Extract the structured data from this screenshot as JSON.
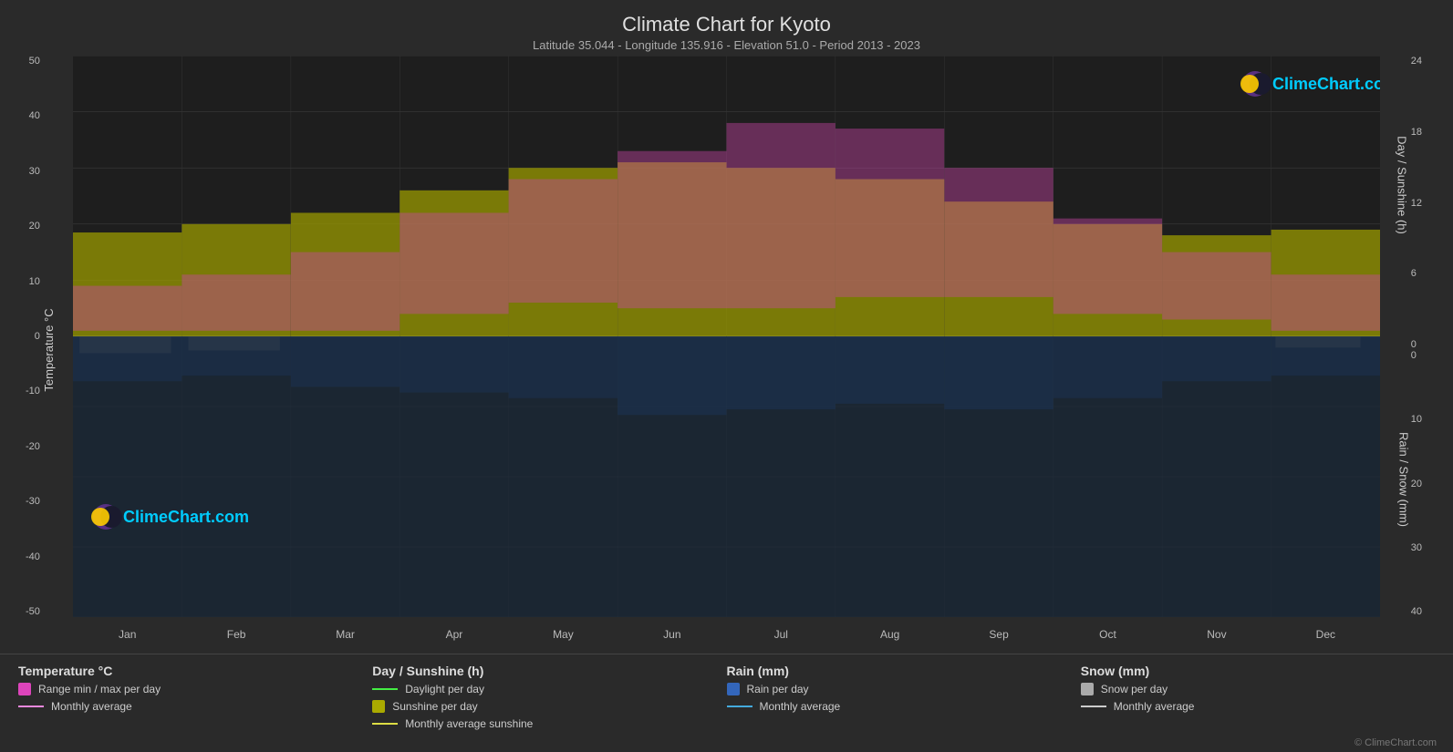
{
  "header": {
    "title": "Climate Chart for Kyoto",
    "subtitle": "Latitude 35.044 - Longitude 135.916 - Elevation 51.0 - Period 2013 - 2023"
  },
  "yaxis_left": {
    "title": "Temperature °C",
    "labels": [
      "50",
      "40",
      "30",
      "20",
      "10",
      "0",
      "-10",
      "-20",
      "-30",
      "-40",
      "-50"
    ]
  },
  "yaxis_right_top": {
    "title": "Day / Sunshine (h)",
    "labels": [
      "24",
      "18",
      "12",
      "6",
      "0"
    ]
  },
  "yaxis_right_bottom": {
    "title": "Rain / Snow (mm)",
    "labels": [
      "0",
      "10",
      "20",
      "30",
      "40"
    ]
  },
  "xaxis": {
    "labels": [
      "Jan",
      "Feb",
      "Mar",
      "Apr",
      "May",
      "Jun",
      "Jul",
      "Aug",
      "Sep",
      "Oct",
      "Nov",
      "Dec"
    ]
  },
  "legend": {
    "col1": {
      "title": "Temperature °C",
      "items": [
        {
          "type": "rect",
          "color": "#dd44cc",
          "label": "Range min / max per day"
        },
        {
          "type": "line",
          "color": "#ee88dd",
          "label": "Monthly average"
        }
      ]
    },
    "col2": {
      "title": "Day / Sunshine (h)",
      "items": [
        {
          "type": "line",
          "color": "#44dd44",
          "label": "Daylight per day"
        },
        {
          "type": "rect",
          "color": "#cccc22",
          "label": "Sunshine per day"
        },
        {
          "type": "line",
          "color": "#dddd44",
          "label": "Monthly average sunshine"
        }
      ]
    },
    "col3": {
      "title": "Rain (mm)",
      "items": [
        {
          "type": "rect",
          "color": "#4488cc",
          "label": "Rain per day"
        },
        {
          "type": "line",
          "color": "#44aadd",
          "label": "Monthly average"
        }
      ]
    },
    "col4": {
      "title": "Snow (mm)",
      "items": [
        {
          "type": "rect",
          "color": "#aaaaaa",
          "label": "Snow per day"
        },
        {
          "type": "line",
          "color": "#cccccc",
          "label": "Monthly average"
        }
      ]
    }
  },
  "brand": {
    "name": "ClimeChart.com",
    "copyright": "© ClimeChart.com"
  }
}
